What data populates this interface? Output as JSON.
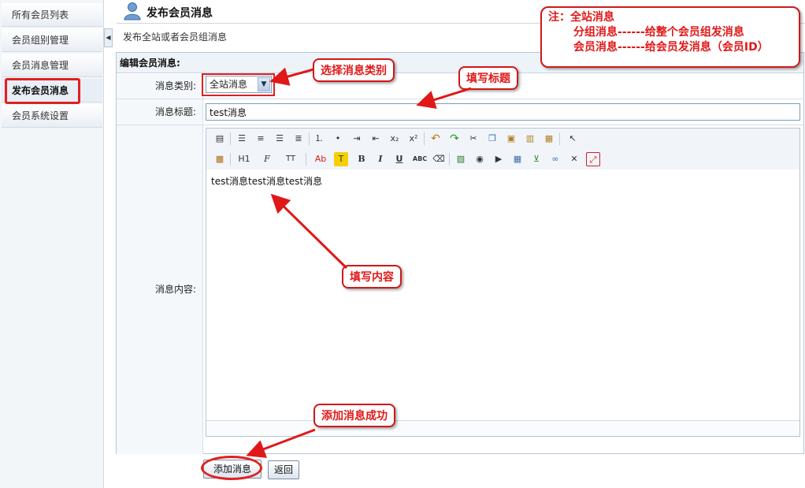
{
  "sidebar": {
    "items": [
      {
        "label": "所有会员列表"
      },
      {
        "label": "会员组别管理"
      },
      {
        "label": "会员消息管理"
      },
      {
        "label": "发布会员消息"
      },
      {
        "label": "会员系统设置"
      }
    ],
    "active_index": 3
  },
  "header": {
    "title": "发布会员消息",
    "subtitle": "发布全站或者会员组消息"
  },
  "form": {
    "section_title": "编辑会员消息:",
    "type_label": "消息类别:",
    "type_value": "全站消息",
    "title_label": "消息标题:",
    "title_value": "test消息",
    "content_label": "消息内容:",
    "content_value": "test消息test消息test消息"
  },
  "editor": {
    "toolbar_row1": [
      "paste-word-icon",
      "align-left-icon",
      "align-center-icon",
      "align-right-icon",
      "align-justify-icon",
      "ordered-list-icon",
      "unordered-list-icon",
      "indent-icon",
      "outdent-icon",
      "subscript-icon",
      "superscript-icon",
      "undo-icon",
      "redo-icon",
      "cut-icon",
      "copy-icon",
      "paste-icon",
      "paste-text-icon",
      "paste-html-icon",
      "select-icon"
    ],
    "toolbar_row2": {
      "heading": "H1",
      "font": "F",
      "size": "TT",
      "text_color": "Ab",
      "bg_color": "T",
      "bold": "B",
      "italic": "I",
      "underline": "U",
      "strike": "ABC"
    }
  },
  "buttons": {
    "submit": "添加消息",
    "back": "返回"
  },
  "annotations": {
    "note_line1": "注：全站消息",
    "note_line2": "分组消息------给整个会员组发消息",
    "note_line3": "会员消息------给会员发消息（会员ID）",
    "choose_type": "选择消息类别",
    "fill_title": "填写标题",
    "fill_content": "填写内容",
    "add_success": "添加消息成功"
  },
  "colors": {
    "annotation_red": "#e01818",
    "panel_border": "#b6c6d6",
    "label_bg": "#f5f8fb"
  }
}
